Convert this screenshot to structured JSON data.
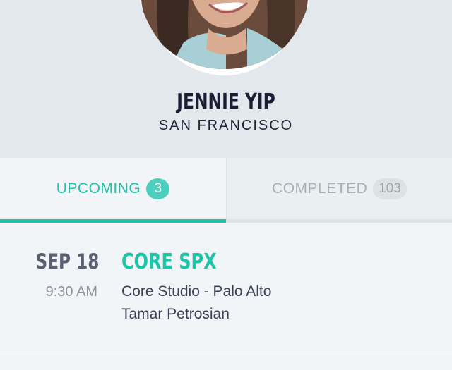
{
  "profile": {
    "name": "JENNIE YIP",
    "city": "SAN FRANCISCO"
  },
  "tabs": [
    {
      "label": "UPCOMING",
      "count": "3",
      "active": true
    },
    {
      "label": "COMPLETED",
      "count": "103",
      "active": false
    }
  ],
  "classes": [
    {
      "date": "SEP 18",
      "time": "9:30 AM",
      "name": "CORE SPX",
      "location": "Core Studio - Palo Alto",
      "instructor": "Tamar Petrosian"
    }
  ],
  "colors": {
    "accent": "#1fc4a8",
    "header_bg": "#e2e8eb"
  }
}
